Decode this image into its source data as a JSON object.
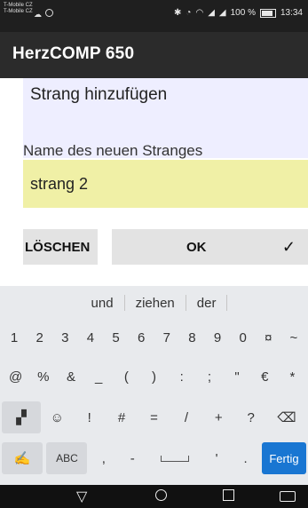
{
  "status_bar": {
    "carrier_line1": "T-Mobile CZ",
    "carrier_line2": "T-Mobile CZ",
    "battery_text": "100 %",
    "time": "13:34"
  },
  "app_bar": {
    "title": "HerzCOMP 650"
  },
  "dialog": {
    "header": "Strang hinzufügen",
    "field_label": "Name des neuen Stranges",
    "field_value": "strang 2",
    "clear_button": "LÖSCHEN",
    "ok_button": "OK",
    "ok_check": "✓"
  },
  "keyboard": {
    "suggestions": [
      "und",
      "ziehen",
      "der"
    ],
    "row1": [
      "1",
      "2",
      "3",
      "4",
      "5",
      "6",
      "7",
      "8",
      "9",
      "0",
      "¤",
      "~"
    ],
    "row2": [
      "@",
      "%",
      "&",
      "_",
      "(",
      ")",
      ":",
      ";",
      "\"",
      "€",
      "*"
    ],
    "row3_keys": [
      "☺",
      "!",
      "#",
      "=",
      "/",
      "+",
      "?"
    ],
    "row3_backspace": "⌫",
    "row4_mode": "ABC",
    "row4_comma": ",",
    "row4_dash": "-",
    "row4_apostrophe": "'",
    "row4_period": ".",
    "fertig": "Fertig"
  },
  "nav_bar": {
    "back_symbol": "▽"
  },
  "colors": {
    "app_bar": "#2b2b2b",
    "header_panel": "#eeeeff",
    "input_bg": "#f0f0a6",
    "fertig_blue": "#1976d2"
  }
}
